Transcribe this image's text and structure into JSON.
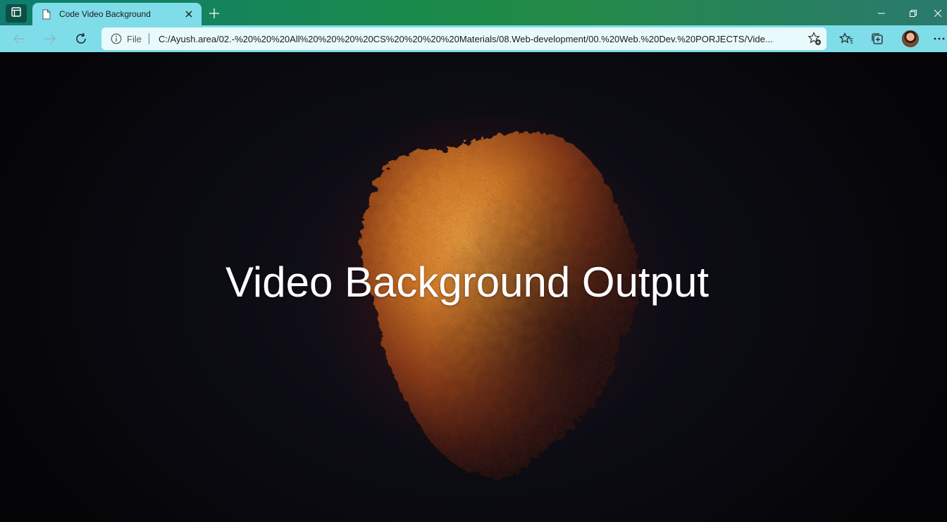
{
  "browser": {
    "tab": {
      "title": "Code Video Background",
      "icon": "page-icon"
    },
    "address": {
      "scheme_label": "File",
      "url": "C:/Ayush.area/02.-%20%20%20All%20%20%20%20CS%20%20%20%20Materials/08.Web-development/00.%20Web.%20Dev.%20PORJECTS/Vide..."
    },
    "icons": {
      "tab_actions": "tab-actions-icon",
      "close_tab": "close-icon",
      "new_tab": "plus-icon",
      "minimize": "minimize-icon",
      "restore": "restore-icon",
      "close_window": "close-icon",
      "back": "arrow-left-icon",
      "forward": "arrow-right-icon",
      "refresh": "refresh-icon",
      "info": "info-icon",
      "add_favorite": "star-plus-icon",
      "favorites": "favorites-icon",
      "collections": "collections-icon",
      "profile": "avatar",
      "more": "more-icon"
    },
    "colors": {
      "tabstrip_start": "#0f7d6f",
      "tabstrip_end": "#2a7a6e",
      "toolbar": "#7fdde9",
      "address_bg": "#e9fafc"
    }
  },
  "page": {
    "headline": "Video Background Output",
    "background": "video-frame-fiery-orb"
  }
}
